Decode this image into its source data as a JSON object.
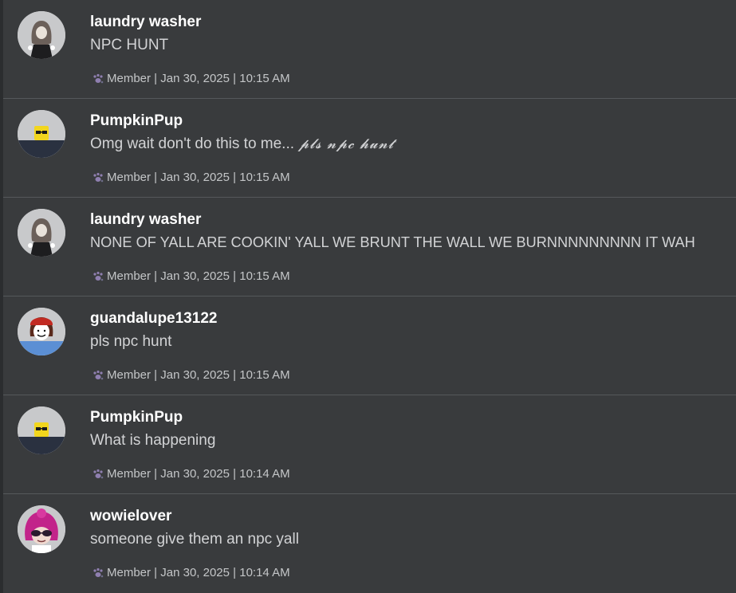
{
  "posts": [
    {
      "username": "laundry washer",
      "message": "NPC HUNT",
      "message_extra": "",
      "role": "Member",
      "date": "Jan 30, 2025",
      "time": "10:15 AM",
      "avatar": "gray-hair-avatar"
    },
    {
      "username": "PumpkinPup",
      "message": "Omg wait don't do this to me...",
      "message_extra": "𝓹𝓵𝓼 𝓷𝓹𝓬 𝓱𝓾𝓷𝓽",
      "role": "Member",
      "date": "Jan 30, 2025",
      "time": "10:15 AM",
      "avatar": "yellow-head-sunglasses-avatar"
    },
    {
      "username": "laundry washer",
      "message": "NONE OF YALL ARE COOKIN' YALL WE BRUNT THE WALL WE BURNNNNNNNNN IT WAH",
      "message_extra": "",
      "role": "Member",
      "date": "Jan 30, 2025",
      "time": "10:15 AM",
      "avatar": "gray-hair-avatar"
    },
    {
      "username": "guandalupe13122",
      "message": "pls npc hunt",
      "message_extra": "",
      "role": "Member",
      "date": "Jan 30, 2025",
      "time": "10:15 AM",
      "avatar": "red-hat-avatar"
    },
    {
      "username": "PumpkinPup",
      "message": "What is happening",
      "message_extra": "",
      "role": "Member",
      "date": "Jan 30, 2025",
      "time": "10:14 AM",
      "avatar": "yellow-head-sunglasses-avatar"
    },
    {
      "username": "wowielover",
      "message": "someone give them an npc yall",
      "message_extra": "",
      "role": "Member",
      "date": "Jan 30, 2025",
      "time": "10:14 AM",
      "avatar": "pink-hair-sunglasses-avatar"
    }
  ],
  "separator": " | ",
  "colors": {
    "background": "#393b3d",
    "divider": "#55585b",
    "username": "#ffffff",
    "message": "#d2d3d5",
    "meta": "#c4c6c8"
  }
}
